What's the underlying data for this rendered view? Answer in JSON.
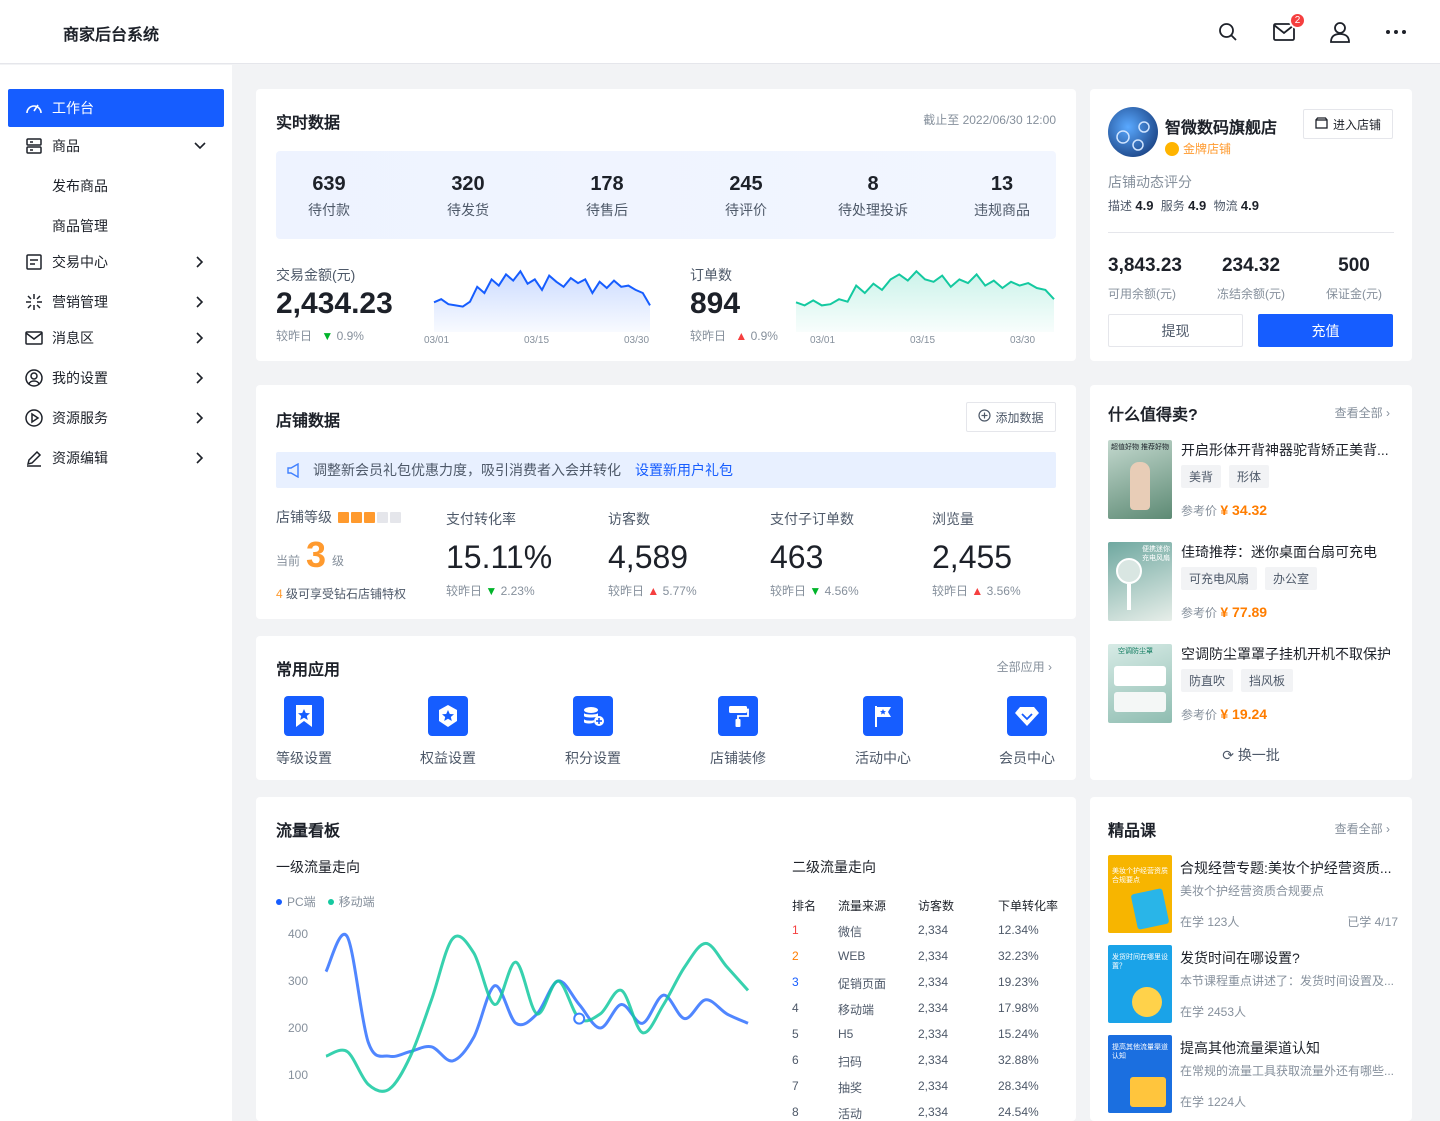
{
  "header": {
    "title": "商家后台系统",
    "mail_badge": "2"
  },
  "sidebar": {
    "items": [
      {
        "label": "工作台",
        "icon": "dashboard-icon",
        "active": true
      },
      {
        "label": "商品",
        "icon": "goods-icon",
        "expanded": true
      },
      {
        "label": "发布商品",
        "sub": true
      },
      {
        "label": "商品管理",
        "sub": true
      },
      {
        "label": "交易中心",
        "icon": "trade-icon"
      },
      {
        "label": "营销管理",
        "icon": "marketing-icon"
      },
      {
        "label": "消息区",
        "icon": "mail-icon"
      },
      {
        "label": "我的设置",
        "icon": "user-icon"
      },
      {
        "label": "资源服务",
        "icon": "play-icon"
      },
      {
        "label": "资源编辑",
        "icon": "edit-icon"
      }
    ]
  },
  "realtime": {
    "title": "实时数据",
    "updated": "截止至 2022/06/30 12:00",
    "stats": [
      {
        "value": "639",
        "label": "待付款"
      },
      {
        "value": "320",
        "label": "待发货"
      },
      {
        "value": "178",
        "label": "待售后"
      },
      {
        "value": "245",
        "label": "待评价"
      },
      {
        "value": "8",
        "label": "待处理投诉"
      },
      {
        "value": "13",
        "label": "违规商品"
      }
    ],
    "amount": {
      "label": "交易金额(元)",
      "value": "2,434.23",
      "compare": "较昨日",
      "change": "0.9%",
      "dir": "down"
    },
    "orders": {
      "label": "订单数",
      "value": "894",
      "compare": "较昨日",
      "change": "0.9%",
      "dir": "up"
    },
    "dates": [
      "03/01",
      "03/15",
      "03/30"
    ],
    "amount_series": [
      0.35,
      0.4,
      0.32,
      0.3,
      0.28,
      0.36,
      0.6,
      0.5,
      0.72,
      0.62,
      0.8,
      0.7,
      0.85,
      0.65,
      0.72,
      0.55,
      0.78,
      0.68,
      0.6,
      0.74,
      0.66,
      0.72,
      0.5,
      0.68,
      0.58,
      0.7,
      0.6,
      0.62,
      0.55,
      0.5,
      0.3
    ],
    "orders_series": [
      0.35,
      0.3,
      0.38,
      0.3,
      0.32,
      0.4,
      0.36,
      0.62,
      0.5,
      0.65,
      0.55,
      0.72,
      0.8,
      0.7,
      0.85,
      0.72,
      0.68,
      0.78,
      0.6,
      0.72,
      0.66,
      0.8,
      0.62,
      0.7,
      0.58,
      0.68,
      0.62,
      0.66,
      0.58,
      0.55,
      0.4
    ],
    "colors": {
      "amount": "#165dff",
      "orders": "#14c9a0"
    }
  },
  "shop": {
    "name": "智微数码旗舰店",
    "level_badge": "金牌店铺",
    "enter_button": "进入店铺",
    "rating_title": "店铺动态评分",
    "ratings": [
      {
        "label": "描述",
        "value": "4.9"
      },
      {
        "label": "服务",
        "value": "4.9"
      },
      {
        "label": "物流",
        "value": "4.9"
      }
    ],
    "balances": [
      {
        "value": "3,843.23",
        "label": "可用余额(元)"
      },
      {
        "value": "234.32",
        "label": "冻结余额(元)"
      },
      {
        "value": "500",
        "label": "保证金(元)"
      }
    ],
    "withdraw_button": "提现",
    "recharge_button": "充值"
  },
  "store_data": {
    "title": "店铺数据",
    "add_button": "添加数据",
    "notice": "调整新会员礼包优惠力度，吸引消费者入会并转化",
    "notice_link": "设置新用户礼包",
    "level_label": "店铺等级",
    "level_filled": 3,
    "level_total": 5,
    "current_label": "当前",
    "level_value": "3",
    "level_unit": "级",
    "level_hint_num": "4",
    "level_hint": "级可享受钻石店铺特权",
    "metrics": [
      {
        "label": "支付转化率",
        "value": "15.11%",
        "compare": "较昨日",
        "change": "2.23%",
        "dir": "down"
      },
      {
        "label": "访客数",
        "value": "4,589",
        "compare": "较昨日",
        "change": "5.77%",
        "dir": "up"
      },
      {
        "label": "支付子订单数",
        "value": "463",
        "compare": "较昨日",
        "change": "4.56%",
        "dir": "down"
      },
      {
        "label": "浏览量",
        "value": "2,455",
        "compare": "较昨日",
        "change": "3.56%",
        "dir": "up"
      }
    ]
  },
  "apps": {
    "title": "常用应用",
    "all_link": "全部应用",
    "items": [
      {
        "label": "等级设置",
        "icon": "level-icon"
      },
      {
        "label": "权益设置",
        "icon": "rights-icon"
      },
      {
        "label": "积分设置",
        "icon": "points-icon"
      },
      {
        "label": "店铺装修",
        "icon": "paint-icon"
      },
      {
        "label": "活动中心",
        "icon": "flag-icon"
      },
      {
        "label": "会员中心",
        "icon": "diamond-icon"
      }
    ]
  },
  "hot": {
    "title": "什么值得卖?",
    "view_all": "查看全部",
    "price_label": "参考价",
    "items": [
      {
        "title": "开启形体开背神器驼背矫正美背...",
        "tags": [
          "美背",
          "形体"
        ],
        "price": "¥ 34.32",
        "thumb_text": "超值好物 推荐好物"
      },
      {
        "title": "佳琦推荐：迷你桌面台扇可充电",
        "tags": [
          "可充电风扇",
          "办公室"
        ],
        "price": "¥ 77.89",
        "thumb_text": "便携迷你 充电风扇"
      },
      {
        "title": "空调防尘罩罩子挂机开机不取保护",
        "tags": [
          "防直吹",
          "挡风板"
        ],
        "price": "¥ 19.24",
        "thumb_text": "空调防尘罩"
      }
    ],
    "refresh": "换一批"
  },
  "traffic": {
    "title": "流量看板",
    "primary_title": "一级流量走向",
    "legend": [
      {
        "name": "PC端",
        "color": "#165dff"
      },
      {
        "name": "移动端",
        "color": "#14c9a0"
      }
    ],
    "secondary_title": "二级流量走向",
    "table_headers": [
      "排名",
      "流量来源",
      "访客数",
      "下单转化率"
    ],
    "table_rows": [
      {
        "rank": "1",
        "source": "微信",
        "visitors": "2,334",
        "rate": "12.34%",
        "color": "#f53f3f"
      },
      {
        "rank": "2",
        "source": "WEB",
        "visitors": "2,334",
        "rate": "32.23%",
        "color": "#ff7d00"
      },
      {
        "rank": "3",
        "source": "促销页面",
        "visitors": "2,334",
        "rate": "19.23%",
        "color": "#165dff"
      },
      {
        "rank": "4",
        "source": "移动端",
        "visitors": "2,334",
        "rate": "17.98%",
        "color": "#4e5969"
      },
      {
        "rank": "5",
        "source": "H5",
        "visitors": "2,334",
        "rate": "15.24%",
        "color": "#4e5969"
      },
      {
        "rank": "6",
        "source": "扫码",
        "visitors": "2,334",
        "rate": "32.88%",
        "color": "#4e5969"
      },
      {
        "rank": "7",
        "source": "抽奖",
        "visitors": "2,334",
        "rate": "28.34%",
        "color": "#4e5969"
      },
      {
        "rank": "8",
        "source": "活动",
        "visitors": "2,334",
        "rate": "24.54%",
        "color": "#4e5969"
      }
    ]
  },
  "chart_data": {
    "type": "line",
    "title": "一级流量走向",
    "ylim": [
      50,
      400
    ],
    "y_ticks": [
      100,
      200,
      300,
      400
    ],
    "x": [
      0,
      1,
      2,
      3,
      4,
      5,
      6,
      7,
      8,
      9,
      10,
      11,
      12,
      13,
      14,
      15,
      16,
      17,
      18,
      19,
      20
    ],
    "series": [
      {
        "name": "PC端",
        "values": [
          320,
          395,
          170,
          140,
          150,
          160,
          130,
          180,
          290,
          210,
          230,
          300,
          250,
          200,
          250,
          210,
          270,
          220,
          260,
          230,
          210
        ]
      },
      {
        "name": "移动端",
        "values": [
          140,
          150,
          80,
          70,
          140,
          260,
          390,
          360,
          250,
          340,
          230,
          300,
          220,
          230,
          280,
          190,
          250,
          330,
          380,
          330,
          280
        ]
      }
    ]
  },
  "courses": {
    "title": "精品课",
    "view_all": "查看全部",
    "items": [
      {
        "title": "合规经营专题:美妆个护经营资质...",
        "desc": "美妆个护经营资质合规要点",
        "learners": "在学 123人",
        "progress": "已学 4/17",
        "thumb_text": "美妆个护经营资质合规要点",
        "thumb_color": "#f7b500"
      },
      {
        "title": "发货时间在哪设置?",
        "desc": "本节课程重点讲述了：发货时间设置及...",
        "learners": "在学 2453人",
        "progress": "",
        "thumb_text": "发货时间在哪里设置？",
        "thumb_color": "#1aa3e8"
      },
      {
        "title": "提高其他流量渠道认知",
        "desc": "在常规的流量工具获取流量外还有哪些...",
        "learners": "在学 1224人",
        "progress": "",
        "thumb_text": "提高其他流量渠道认知",
        "thumb_color": "#1b6fe0"
      }
    ]
  }
}
